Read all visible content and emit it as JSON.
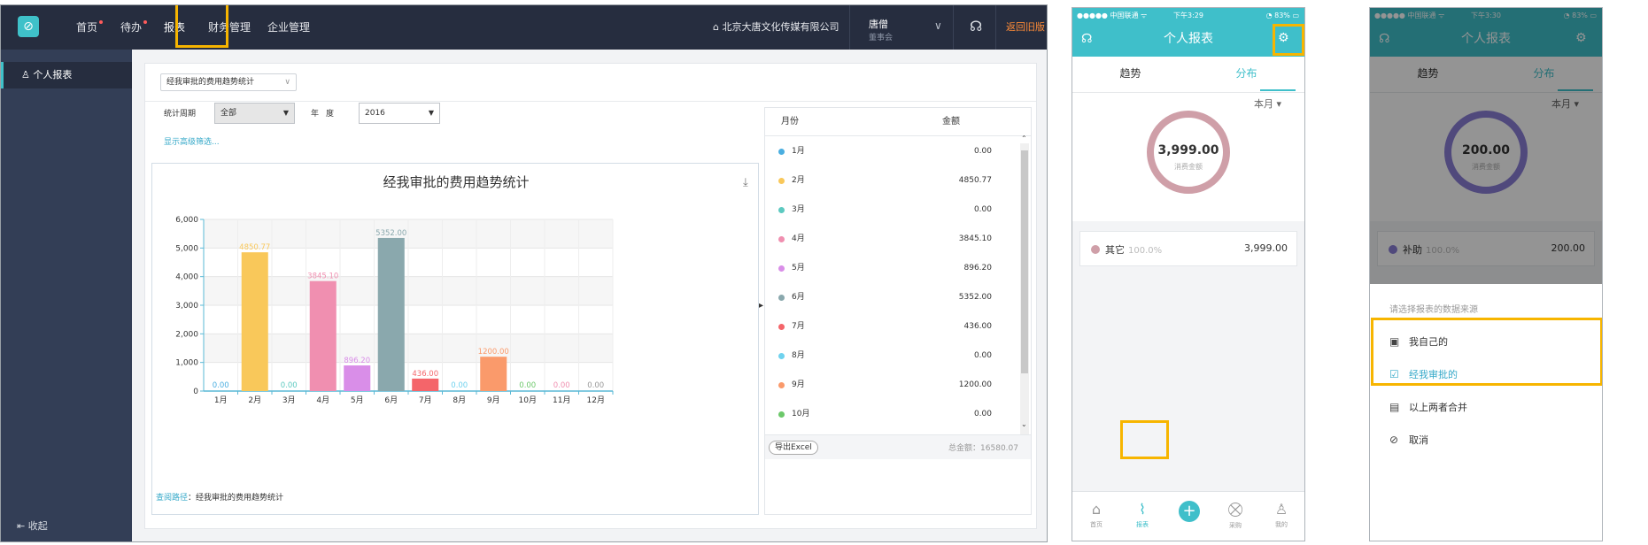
{
  "desktop": {
    "topbar": {
      "logo_glyph": "⊘",
      "nav": [
        "首页",
        "待办",
        "报表",
        "财务管理",
        "企业管理"
      ],
      "company": "北京大唐文化传媒有限公司",
      "company_icon": "home-icon",
      "user_name": "唐僧",
      "user_role": "董事会",
      "old_version_link": "返回旧版"
    },
    "sidebar": {
      "item": "个人报表",
      "collapse": "收起"
    },
    "filters": {
      "scope": "经我审批的费用趋势统计",
      "period_label": "统计周期",
      "period_value": "全部",
      "year_label": "年度",
      "year_value": "2016",
      "advanced": "显示高级筛选..."
    },
    "chart_title": "经我审批的费用趋势统计",
    "query_path_label": "查阅路径",
    "query_path_value": "：经我审批的费用趋势统计",
    "table": {
      "headers": [
        "月份",
        "金额"
      ],
      "rows": [
        {
          "month": "1月",
          "value": "0.00",
          "color": "#4aaee0"
        },
        {
          "month": "2月",
          "value": "4850.77",
          "color": "#f9c85a"
        },
        {
          "month": "3月",
          "value": "0.00",
          "color": "#5cc9c0"
        },
        {
          "month": "4月",
          "value": "3845.10",
          "color": "#f08fb0"
        },
        {
          "month": "5月",
          "value": "896.20",
          "color": "#d98ee8"
        },
        {
          "month": "6月",
          "value": "5352.00",
          "color": "#8aa8ad"
        },
        {
          "month": "7月",
          "value": "436.00",
          "color": "#f4656a"
        },
        {
          "month": "8月",
          "value": "0.00",
          "color": "#6fd2ee"
        },
        {
          "month": "9月",
          "value": "1200.00",
          "color": "#fa9a6b"
        },
        {
          "month": "10月",
          "value": "0.00",
          "color": "#6cc86a"
        }
      ],
      "export_label": "导出Excel",
      "total": "总金额：16580.07"
    }
  },
  "chart_data": {
    "type": "bar",
    "title": "经我审批的费用趋势统计",
    "categories": [
      "1月",
      "2月",
      "3月",
      "4月",
      "5月",
      "6月",
      "7月",
      "8月",
      "9月",
      "10月",
      "11月",
      "12月"
    ],
    "values": [
      0,
      4850.77,
      0,
      3845.1,
      896.2,
      5352.0,
      436.0,
      0,
      1200.0,
      0,
      0,
      0
    ],
    "labels": [
      "0.00",
      "4850.77",
      "0.00",
      "3845.10",
      "896.20",
      "5352.00",
      "436.00",
      "0.00",
      "1200.00",
      "0.00",
      "0.00",
      "0.00"
    ],
    "colors": [
      "#4aaee0",
      "#f9c85a",
      "#5cc9c0",
      "#f08fb0",
      "#d98ee8",
      "#8aa8ad",
      "#f4656a",
      "#6fd2ee",
      "#fa9a6b",
      "#6cc86a",
      "#f08fb0",
      "#999999"
    ],
    "yticks": [
      "0",
      "1,000",
      "2,000",
      "3,000",
      "4,000",
      "5,000",
      "6,000"
    ],
    "ylim": [
      0,
      6000
    ],
    "grid": true
  },
  "phone1": {
    "status_left": "●●●●● 中国联通 ᯤ",
    "status_time": "下午3:29",
    "status_right": "◔ 83% ▭",
    "title": "个人报表",
    "tabs": [
      "趋势",
      "分布"
    ],
    "month_selector": "本月 ▾",
    "donut_amount": "3,999.00",
    "donut_label": "消费金额",
    "ring_color": "#cf9fa8",
    "category": {
      "name": "其它",
      "percent": "100.0%",
      "amount": "3,999.00",
      "color": "#cf9fa8"
    },
    "bottom_nav": [
      "首页",
      "报表",
      "采购",
      "我的"
    ]
  },
  "phone2": {
    "status_left": "●●●●● 中国联通 ᯤ",
    "status_time": "下午3:30",
    "status_right": "◔ 83% ▭",
    "title": "个人报表",
    "tabs": [
      "趋势",
      "分布"
    ],
    "month_selector": "本月 ▾",
    "donut_amount": "200.00",
    "donut_label": "消费金额",
    "ring_color": "#8a7fd6",
    "category": {
      "name": "补助",
      "percent": "100.0%",
      "amount": "200.00",
      "color": "#8a7fd6"
    },
    "sheet": {
      "title": "请选择报表的数据来源",
      "options": [
        "我自己的",
        "经我审批的",
        "以上两者合并",
        "取消"
      ]
    }
  }
}
